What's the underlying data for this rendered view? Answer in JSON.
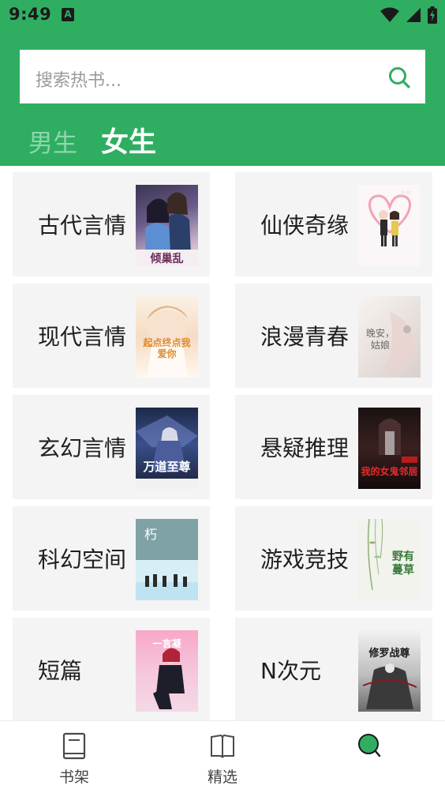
{
  "status_bar": {
    "time": "9:49",
    "app_icon_text": "A"
  },
  "search": {
    "placeholder": "搜索热书...",
    "icon": "search-icon"
  },
  "tabs": {
    "male": "男生",
    "female": "女生",
    "active": "female"
  },
  "categories": [
    {
      "label": "古代言情",
      "cover_text": "倾巢乱"
    },
    {
      "label": "仙侠奇缘",
      "cover_text": ""
    },
    {
      "label": "现代言情",
      "cover_text": "起点终点我爱你"
    },
    {
      "label": "浪漫青春",
      "cover_text": "晚安，姑娘"
    },
    {
      "label": "玄幻言情",
      "cover_text": "万道至尊"
    },
    {
      "label": "悬疑推理",
      "cover_text": "我的女鬼邻居"
    },
    {
      "label": "科幻空间",
      "cover_text": "朽"
    },
    {
      "label": "游戏竞技",
      "cover_text": "野有蔓草"
    },
    {
      "label": "短篇",
      "cover_text": "一言凝"
    },
    {
      "label": "N次元",
      "cover_text": "修罗战尊"
    }
  ],
  "bottom_nav": [
    {
      "label": "书架",
      "icon": "bookshelf-icon"
    },
    {
      "label": "精选",
      "icon": "open-book-icon"
    },
    {
      "label": "",
      "icon": "search-icon"
    }
  ],
  "colors": {
    "brand_green": "#2fae62",
    "card_bg": "#f4f4f4",
    "inactive_tab": "#8fd6ab"
  }
}
